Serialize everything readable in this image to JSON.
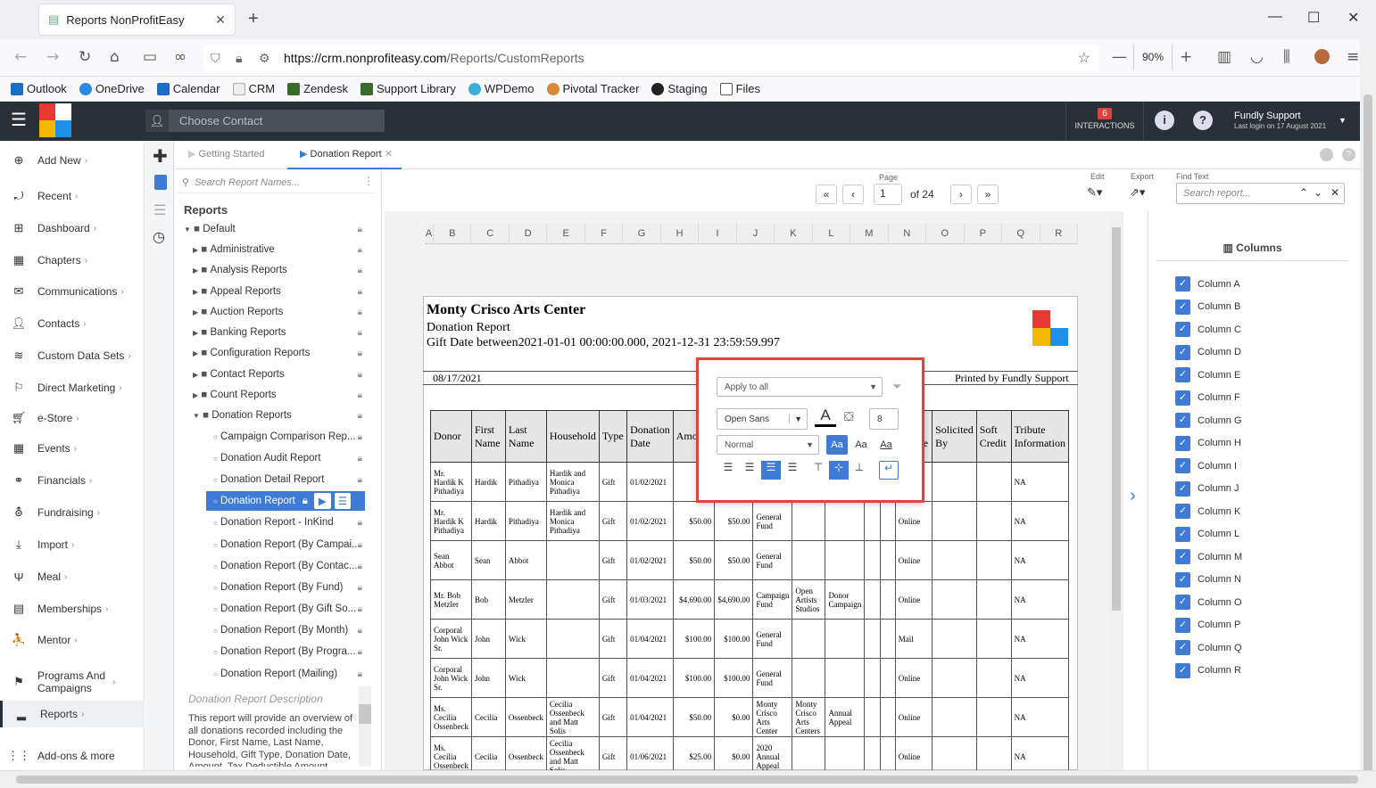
{
  "browser": {
    "tab_title": "Reports NonProfitEasy",
    "url_host": "https://crm.nonprofiteasy.com",
    "url_path": "/Reports/CustomReports",
    "zoom": "90%",
    "bookmarks": [
      "Outlook",
      "OneDrive",
      "Calendar",
      "CRM",
      "Zendesk",
      "Support Library",
      "WPDemo",
      "Pivotal Tracker",
      "Staging",
      "Files"
    ]
  },
  "header": {
    "choose_contact_placeholder": "Choose Contact",
    "interactions_count": "6",
    "interactions_label": "INTERACTIONS",
    "user_name": "Fundly Support",
    "last_login": "Last login on 17 August 2021"
  },
  "nav": [
    "Add New",
    "Recent",
    "Dashboard",
    "Chapters",
    "Communications",
    "Contacts",
    "Custom Data Sets",
    "Direct Marketing",
    "e-Store",
    "Events",
    "Financials",
    "Fundraising",
    "Import",
    "Meal",
    "Memberships",
    "Mentor",
    "Programs And Campaigns",
    "Reports",
    "Add-ons & more"
  ],
  "tabs": {
    "getting_started": "Getting Started",
    "donation_report": "Donation Report"
  },
  "reports": {
    "search_placeholder": "Search Report Names...",
    "heading": "Reports",
    "default": "Default",
    "folders": [
      "Administrative",
      "Analysis Reports",
      "Appeal Reports",
      "Auction Reports",
      "Banking Reports",
      "Configuration Reports",
      "Contact Reports",
      "Count Reports",
      "Donation Reports"
    ],
    "donation_items": [
      "Campaign Comparison Rep...",
      "Donation Audit Report",
      "Donation Detail Report",
      "Donation Report",
      "Donation Report - InKind",
      "Donation Report (By Campai...",
      "Donation Report (By Contac...",
      "Donation Report (By Fund)",
      "Donation Report (By Gift So...",
      "Donation Report (By Month)",
      "Donation Report (By Progra...",
      "Donation Report (Mailing)"
    ],
    "description_heading": "Donation Report Description",
    "description": "This report will provide an overview of all donations recorded including the Donor, First Name, Last Name, Household, Gift Type, Donation Date, Amount, Tax Deductible Amount, fund,"
  },
  "toolbar": {
    "page_label": "Page",
    "page_value": "1",
    "of_pages": "of 24",
    "edit_label": "Edit",
    "export_label": "Export",
    "find_label": "Find Text",
    "find_placeholder": "Search report..."
  },
  "grid_columns": [
    "A",
    "B",
    "C",
    "D",
    "E",
    "F",
    "G",
    "H",
    "I",
    "J",
    "K",
    "L",
    "M",
    "N",
    "O",
    "P",
    "Q",
    "R"
  ],
  "report": {
    "org": "Monty Crisco Arts Center",
    "title": "Donation Report",
    "criteria": "Gift Date between2021-01-01 00:00:00.000, 2021-12-31 23:59:59.997",
    "date": "08/17/2021",
    "printed_by": "Printed by Fundly Support",
    "headers": [
      "Donor",
      "First Name",
      "Last Name",
      "Household",
      "Type",
      "Donation Date",
      "Amount",
      "",
      "",
      "",
      "",
      "",
      "",
      "Gift Source",
      "Solicited By",
      "Soft Credit",
      "Tribute Information"
    ],
    "rows": [
      [
        "Mr. Hardik K Pithadiya",
        "Hardik",
        "Pithadiya",
        "Hardik and Monica Pithadiya",
        "Gift",
        "01/02/2021",
        "$2...",
        "",
        "Fund",
        "",
        "",
        "",
        "Online",
        "",
        "",
        "NA"
      ],
      [
        "Mr. Hardik K Pithadiya",
        "Hardik",
        "Pithadiya",
        "Hardik and Monica Pithadiya",
        "Gift",
        "01/02/2021",
        "$50.00",
        "$50.00",
        "General Fund",
        "",
        "",
        "",
        "Online",
        "",
        "",
        "NA"
      ],
      [
        "Sean Abbot",
        "Sean",
        "Abbot",
        "",
        "Gift",
        "01/02/2021",
        "$50.00",
        "$50.00",
        "General Fund",
        "",
        "",
        "",
        "Online",
        "",
        "",
        "NA"
      ],
      [
        "Mr. Bob Metzler",
        "Bob",
        "Metzler",
        "",
        "Gift",
        "01/03/2021",
        "$4,690.00",
        "$4,690.00",
        "Campaign Fund",
        "Open Artists Studios",
        "Donor Campaign",
        "",
        "Online",
        "",
        "",
        "NA"
      ],
      [
        "Corporal John Wick Sr.",
        "John",
        "Wick",
        "",
        "Gift",
        "01/04/2021",
        "$100.00",
        "$100.00",
        "General Fund",
        "",
        "",
        "",
        "Mail",
        "",
        "",
        "NA"
      ],
      [
        "Corporal John Wick Sr.",
        "John",
        "Wick",
        "",
        "Gift",
        "01/04/2021",
        "$100.00",
        "$100.00",
        "General Fund",
        "",
        "",
        "",
        "Online",
        "",
        "",
        "NA"
      ],
      [
        "Ms. Cecilia Ossenbeck",
        "Cecilia",
        "Ossenbeck",
        "Cecilia Ossenbeck and Matt Solis",
        "Gift",
        "01/04/2021",
        "$50.00",
        "$0.00",
        "Monty Crisco Arts Center",
        "Monty Crisco Arts Centers",
        "Annual Appeal",
        "",
        "Online",
        "",
        "",
        "NA"
      ],
      [
        "Ms. Cecilia Ossenbeck",
        "Cecilia",
        "Ossenbeck",
        "Cecilia Ossenbeck and Matt Solis",
        "Gift",
        "01/06/2021",
        "$25.00",
        "$0.00",
        "2020 Annual Appeal",
        "",
        "",
        "",
        "Online",
        "",
        "",
        "NA"
      ]
    ]
  },
  "format_popup": {
    "apply_to": "Apply to all",
    "font": "Open Sans",
    "size": "8",
    "style": "Normal",
    "aa": "Aa"
  },
  "columns_panel": {
    "heading": "Columns",
    "items": [
      "Column A",
      "Column B",
      "Column C",
      "Column D",
      "Column E",
      "Column F",
      "Column G",
      "Column H",
      "Column I",
      "Column J",
      "Column K",
      "Column L",
      "Column M",
      "Column N",
      "Column O",
      "Column P",
      "Column Q",
      "Column R"
    ]
  }
}
